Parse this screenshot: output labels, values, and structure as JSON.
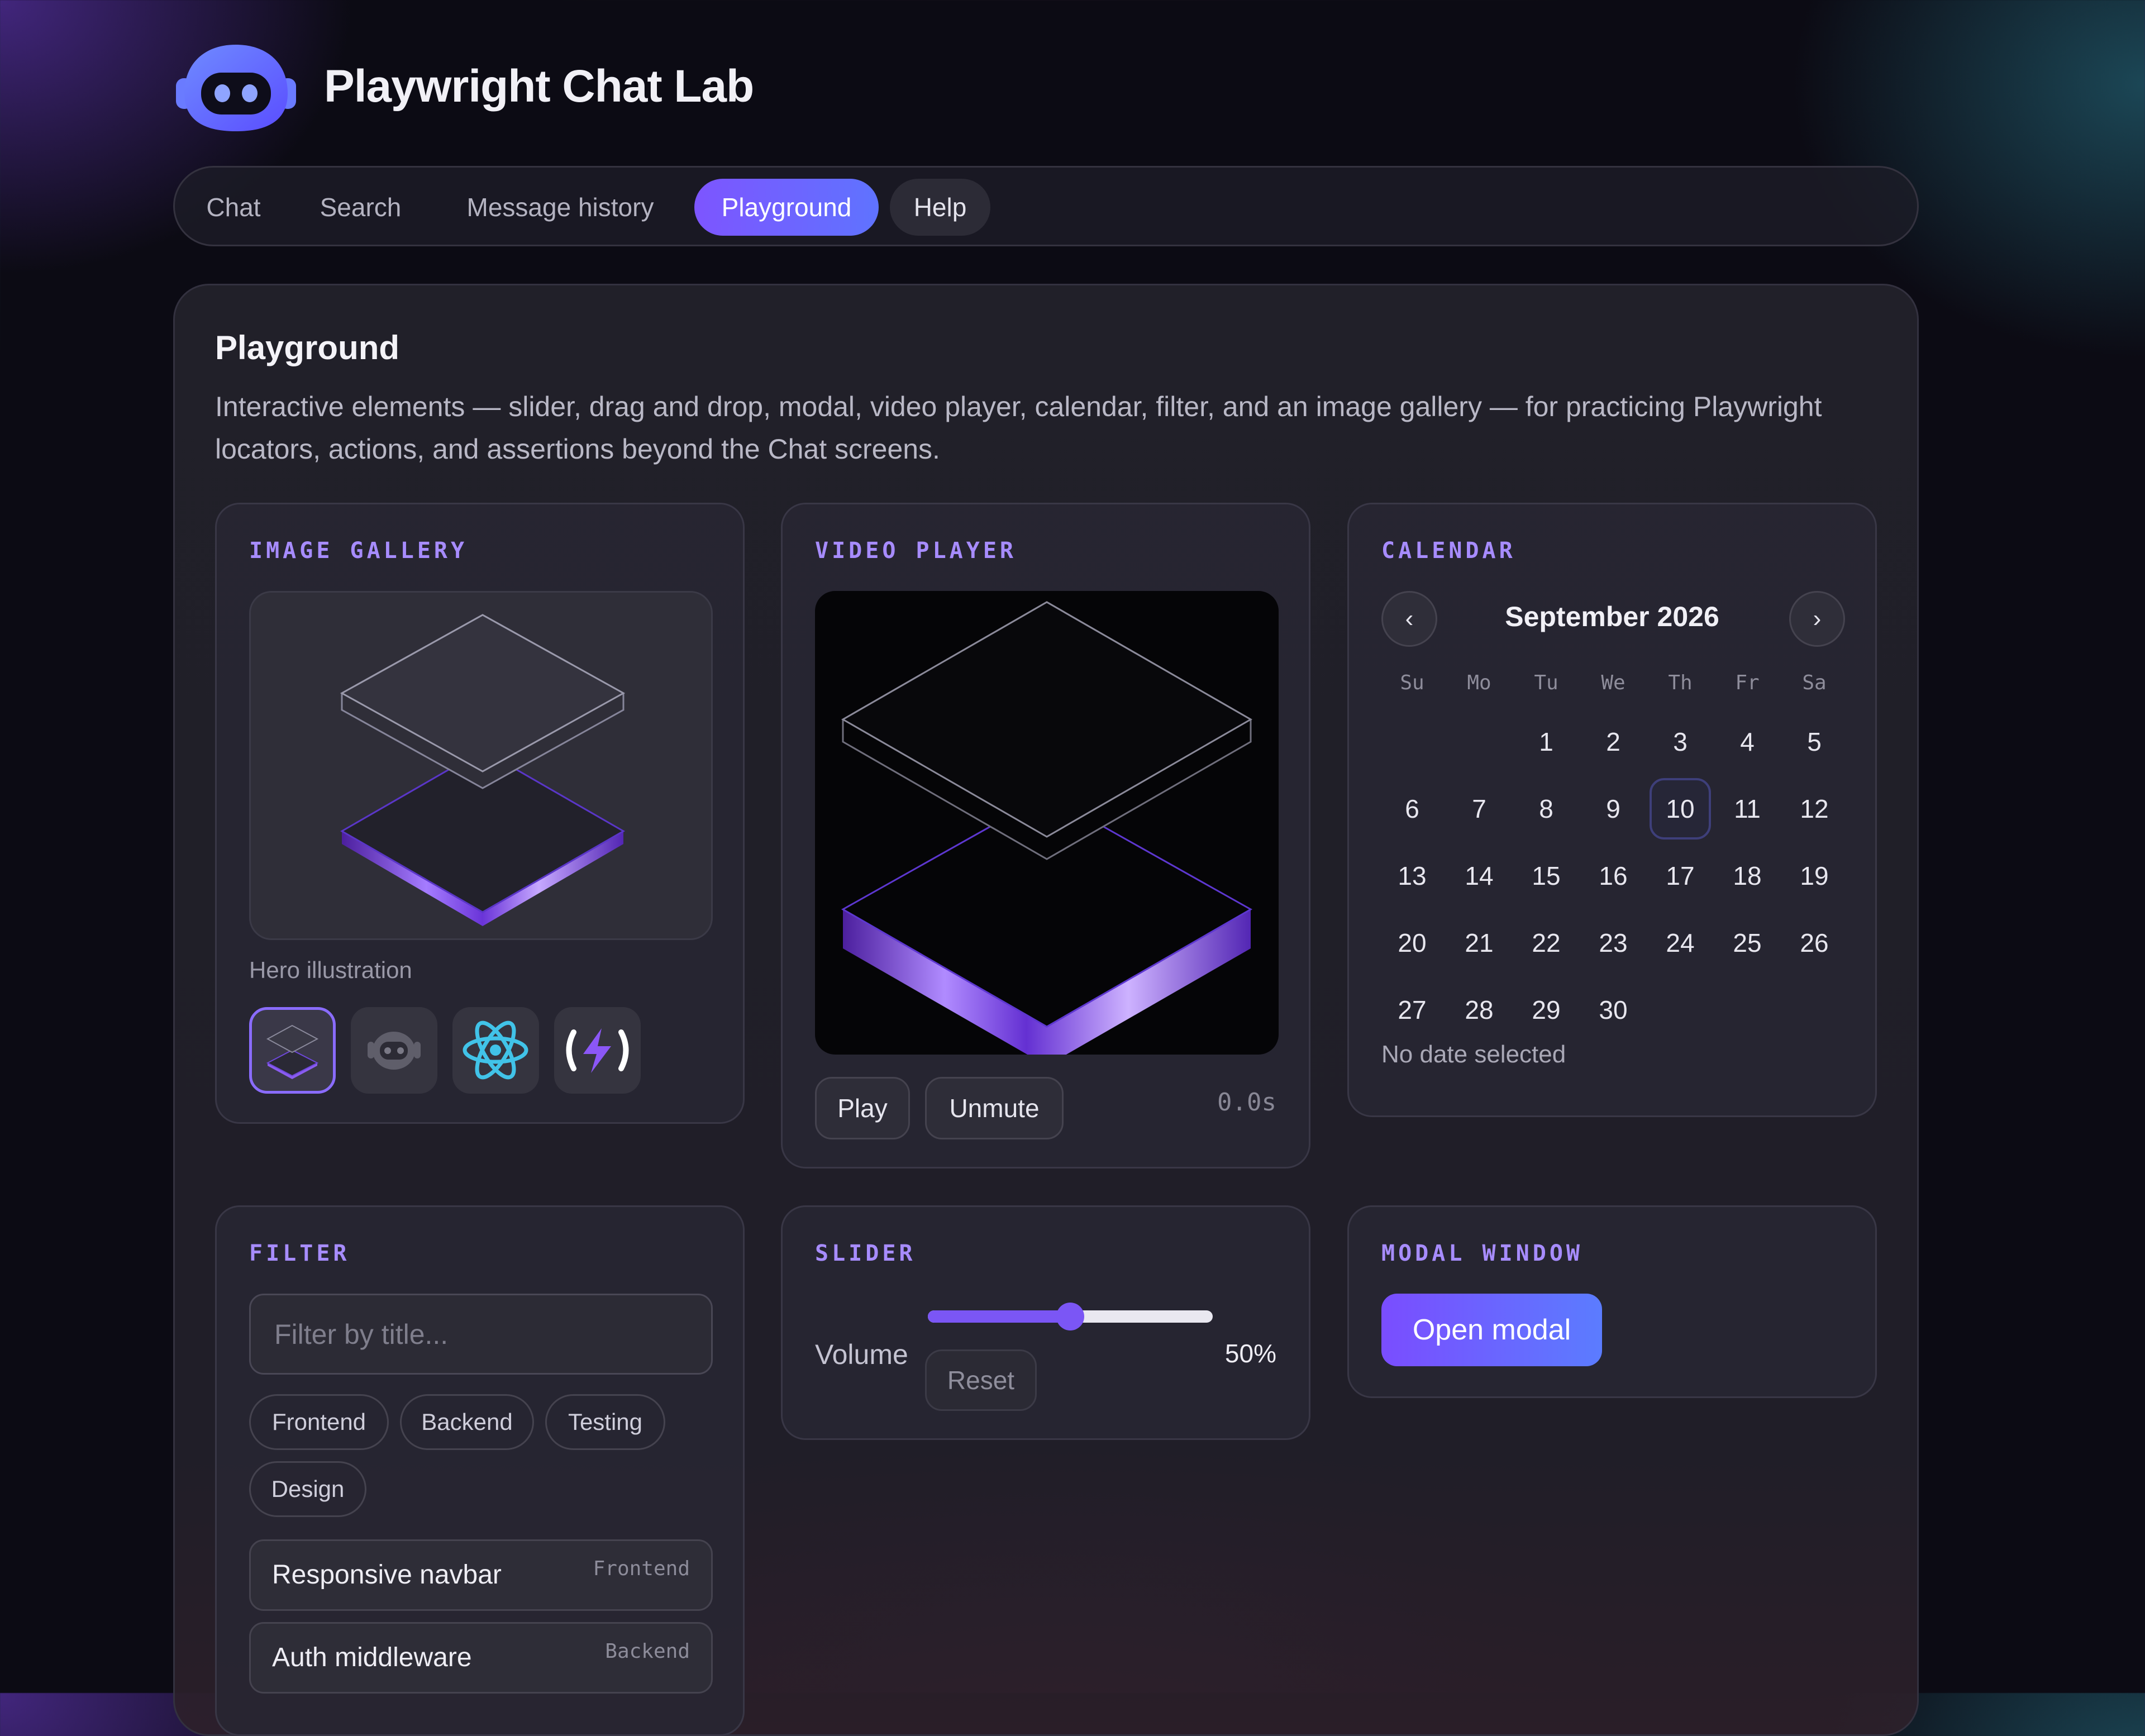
{
  "app": {
    "title": "Playwright Chat Lab"
  },
  "nav": {
    "tabs": [
      {
        "label": "Chat",
        "active": false
      },
      {
        "label": "Search",
        "active": false
      },
      {
        "label": "Message history",
        "active": false
      },
      {
        "label": "Playground",
        "active": true
      },
      {
        "label": "Help",
        "active": false
      }
    ]
  },
  "page": {
    "title": "Playground",
    "description": "Interactive elements — slider, drag and drop, modal, video player, calendar, filter, and an image gallery — for practicing Playwright locators, actions, and assertions beyond the Chat screens."
  },
  "gallery": {
    "title": "IMAGE GALLERY",
    "caption": "Hero illustration",
    "thumbnails": [
      {
        "icon": "layers-hero-icon",
        "selected": true
      },
      {
        "icon": "robot-icon",
        "selected": false
      },
      {
        "icon": "react-atom-icon",
        "selected": false
      },
      {
        "icon": "lightning-braces-icon",
        "selected": false
      }
    ]
  },
  "video": {
    "title": "VIDEO PLAYER",
    "play_label": "Play",
    "mute_label": "Unmute",
    "time": "0.0s"
  },
  "calendar": {
    "title": "CALENDAR",
    "month_label": "September 2026",
    "prev_glyph": "‹",
    "next_glyph": "›",
    "weekdays": [
      "Su",
      "Mo",
      "Tu",
      "We",
      "Th",
      "Fr",
      "Sa"
    ],
    "first_weekday_index": 2,
    "days_in_month": 30,
    "highlighted_day": 10,
    "status": "No date selected"
  },
  "filter": {
    "title": "FILTER",
    "placeholder": "Filter by title...",
    "chips": [
      "Frontend",
      "Backend",
      "Testing",
      "Design"
    ],
    "results": [
      {
        "title": "Responsive navbar",
        "tag": "Frontend"
      },
      {
        "title": "Auth middleware",
        "tag": "Backend"
      }
    ]
  },
  "slider": {
    "title": "SLIDER",
    "label": "Volume",
    "value_percent": 50,
    "value_text": "50%",
    "reset_label": "Reset"
  },
  "modal": {
    "title": "MODAL WINDOW",
    "open_label": "Open modal"
  },
  "colors": {
    "accent": "#7b56f5",
    "accent_gradient_end": "#5f73ff",
    "section_title": "#a78cff",
    "background": "#0c0b14"
  }
}
